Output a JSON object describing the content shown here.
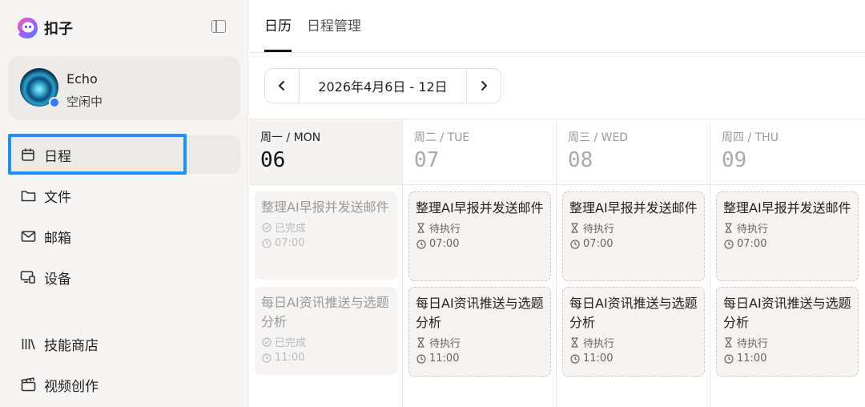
{
  "app": {
    "name": "扣子"
  },
  "user": {
    "name": "Echo",
    "status": "空闲中"
  },
  "sidebar": {
    "items": [
      {
        "label": "日程",
        "icon": "calendar-icon"
      },
      {
        "label": "文件",
        "icon": "folder-icon"
      },
      {
        "label": "邮箱",
        "icon": "mail-icon"
      },
      {
        "label": "设备",
        "icon": "device-icon"
      },
      {
        "label": "技能商店",
        "icon": "library-icon"
      },
      {
        "label": "视频创作",
        "icon": "clapperboard-icon"
      }
    ]
  },
  "tabs": [
    {
      "label": "日历"
    },
    {
      "label": "日程管理"
    }
  ],
  "date_range": "2026年4月6日 - 12日",
  "days": [
    {
      "label": "周一 / MON",
      "num": "06",
      "tasks": [
        {
          "title": "整理AI早报并发送邮件",
          "status": "已完成",
          "time": "07:00"
        },
        {
          "title": "每日AI资讯推送与选题分析",
          "status": "已完成",
          "time": "11:00"
        }
      ]
    },
    {
      "label": "周二 / TUE",
      "num": "07",
      "tasks": [
        {
          "title": "整理AI早报并发送邮件",
          "status": "待执行",
          "time": "07:00"
        },
        {
          "title": "每日AI资讯推送与选题分析",
          "status": "待执行",
          "time": "11:00"
        }
      ]
    },
    {
      "label": "周三 / WED",
      "num": "08",
      "tasks": [
        {
          "title": "整理AI早报并发送邮件",
          "status": "待执行",
          "time": "07:00"
        },
        {
          "title": "每日AI资讯推送与选题分析",
          "status": "待执行",
          "time": "11:00"
        }
      ]
    },
    {
      "label": "周四 / THU",
      "num": "09",
      "tasks": [
        {
          "title": "整理AI早报并发送邮件",
          "status": "待执行",
          "time": "07:00"
        },
        {
          "title": "每日AI资讯推送与选题分析",
          "status": "待执行",
          "time": "11:00"
        }
      ]
    }
  ],
  "colors": {
    "accent": "#1e8fff",
    "status_online": "#2f7cf6"
  }
}
